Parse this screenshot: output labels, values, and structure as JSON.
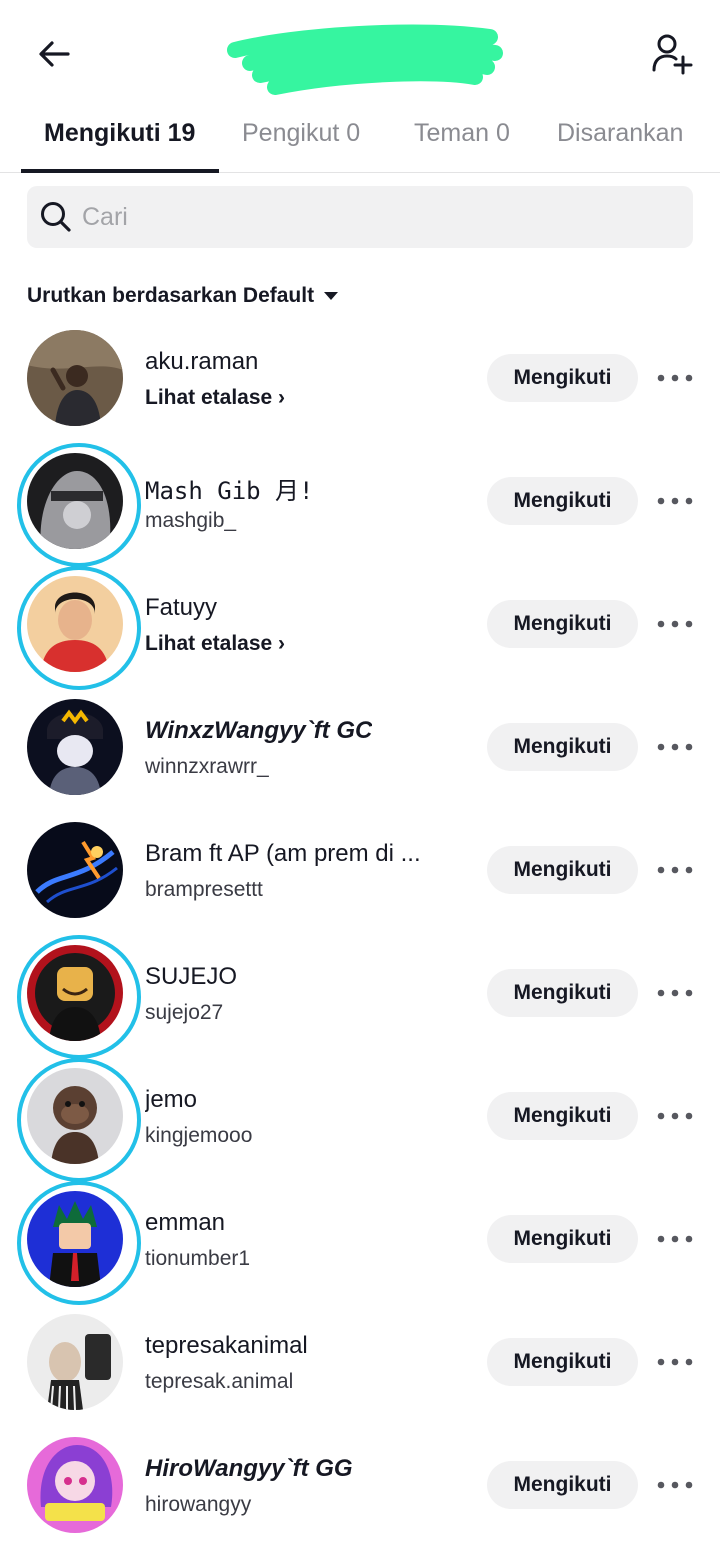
{
  "header": {
    "back_icon": "arrow-left-icon",
    "add_user_icon": "person-add-icon"
  },
  "tabs": [
    {
      "label": "Mengikuti 19",
      "active": true
    },
    {
      "label": "Pengikut 0",
      "active": false
    },
    {
      "label": "Teman 0",
      "active": false
    },
    {
      "label": "Disarankan",
      "active": false
    }
  ],
  "search": {
    "placeholder": "Cari",
    "icon": "search-icon"
  },
  "sort": {
    "label": "Urutkan berdasarkan Default"
  },
  "colors": {
    "story_ring": "#22c0e8",
    "button_bg": "#f1f1f2",
    "text": "#161823",
    "muted": "#8a8b91"
  },
  "follow_button_label": "Mengikuti",
  "users": [
    {
      "name": "aku.raman",
      "sub": "Lihat etalase ›",
      "sub_is_link": true,
      "story": false,
      "italic": false
    },
    {
      "name": "Mash Gib 月!",
      "sub": "mashgib_",
      "sub_is_link": false,
      "story": true,
      "italic": false
    },
    {
      "name": "Fatuyy",
      "sub": "Lihat etalase ›",
      "sub_is_link": true,
      "story": true,
      "italic": false
    },
    {
      "name": "WinxzWangyy`ft GC",
      "sub": "winnzxrawrr_",
      "sub_is_link": false,
      "story": false,
      "italic": true
    },
    {
      "name": "Bram ft AP (am prem di ...",
      "sub": "brampresettt",
      "sub_is_link": false,
      "story": false,
      "italic": false
    },
    {
      "name": "SUJEJO",
      "sub": "sujejo27",
      "sub_is_link": false,
      "story": true,
      "italic": false
    },
    {
      "name": "jemo",
      "sub": "kingjemooo",
      "sub_is_link": false,
      "story": true,
      "italic": false
    },
    {
      "name": "emman",
      "sub": "tionumber1",
      "sub_is_link": false,
      "story": true,
      "italic": false
    },
    {
      "name": "tepresakanimal",
      "sub": "tepresak.animal",
      "sub_is_link": false,
      "story": false,
      "italic": false
    },
    {
      "name": "HiroWangyy`ft GG",
      "sub": "hirowangyy",
      "sub_is_link": false,
      "story": false,
      "italic": true
    }
  ]
}
